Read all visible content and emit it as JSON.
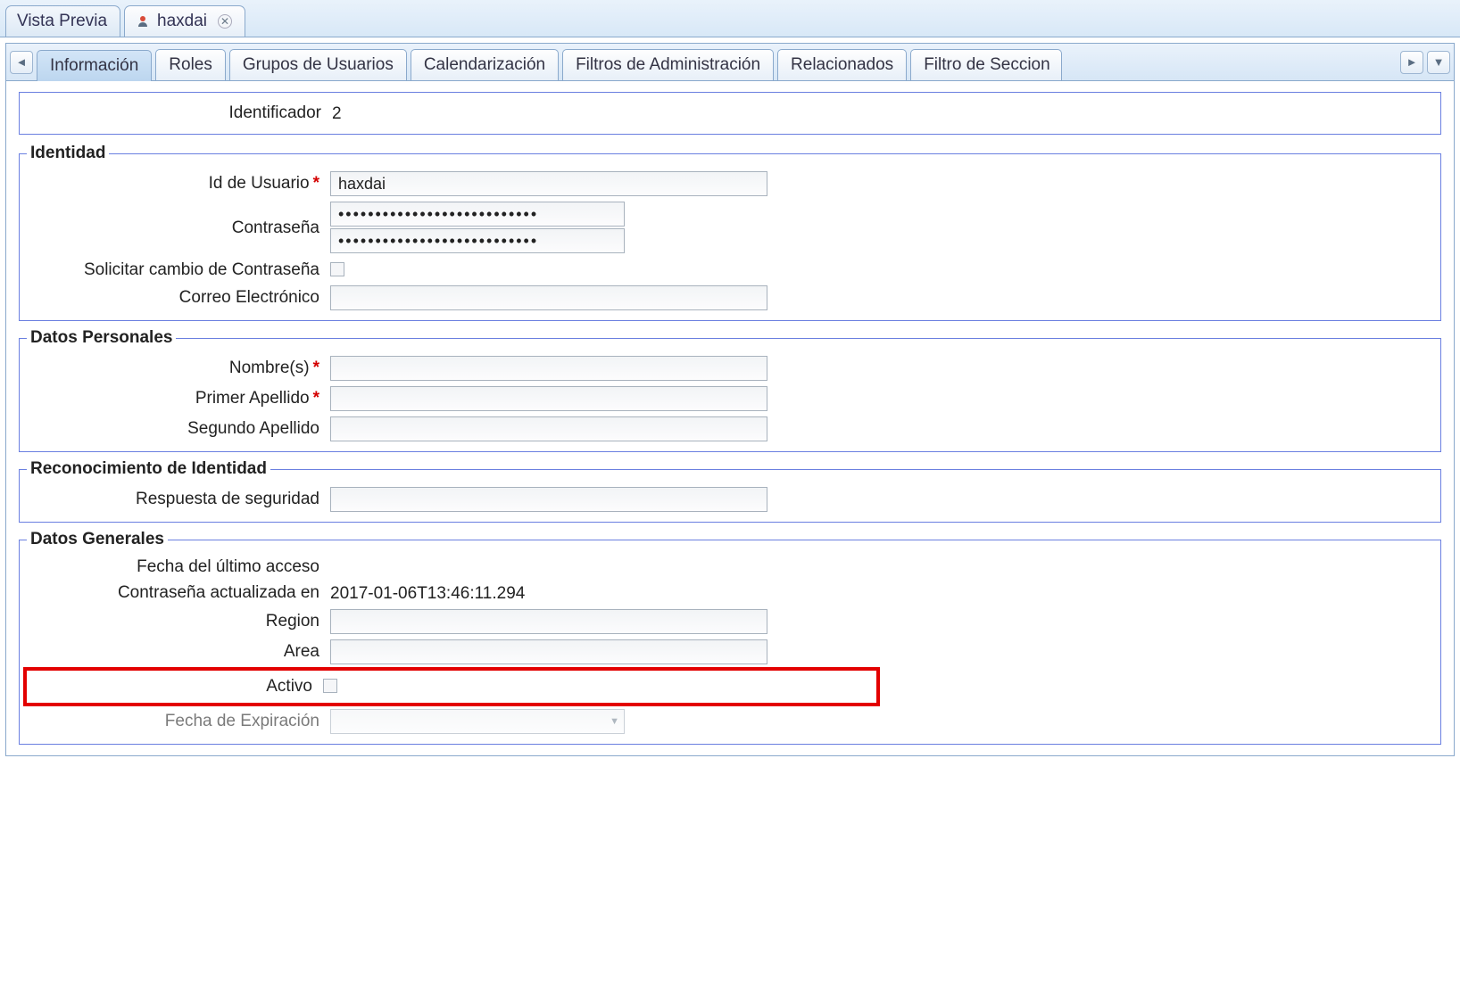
{
  "doc_tabs": {
    "preview_label": "Vista Previa",
    "user_label": "haxdai"
  },
  "sub_tabs": {
    "informacion": "Información",
    "roles": "Roles",
    "grupos": "Grupos de Usuarios",
    "calendarizacion": "Calendarización",
    "filtros_admin": "Filtros de Administración",
    "relacionados": "Relacionados",
    "filtro_seccion": "Filtro de Seccion"
  },
  "top_field": {
    "identificador_label": "Identificador",
    "identificador_value": "2"
  },
  "identidad": {
    "legend": "Identidad",
    "id_usuario_label": "Id de Usuario",
    "id_usuario_value": "haxdai",
    "contrasena_label": "Contraseña",
    "pw_mask": "•••••••••••••••••••••••••••",
    "solicitar_cambio_label": "Solicitar cambio de Contraseña",
    "correo_label": "Correo Electrónico",
    "correo_value": ""
  },
  "datos_personales": {
    "legend": "Datos Personales",
    "nombres_label": "Nombre(s)",
    "nombres_value": "",
    "primer_apellido_label": "Primer Apellido",
    "primer_apellido_value": "",
    "segundo_apellido_label": "Segundo Apellido",
    "segundo_apellido_value": ""
  },
  "reconocimiento": {
    "legend": "Reconocimiento de Identidad",
    "respuesta_label": "Respuesta de seguridad",
    "respuesta_value": ""
  },
  "datos_generales": {
    "legend": "Datos Generales",
    "ultimo_acceso_label": "Fecha del último acceso",
    "ultimo_acceso_value": "",
    "pw_actualizada_label": "Contraseña actualizada en",
    "pw_actualizada_value": "2017-01-06T13:46:11.294",
    "region_label": "Region",
    "region_value": "",
    "area_label": "Area",
    "area_value": "",
    "activo_label": "Activo",
    "fecha_expiracion_label": "Fecha de Expiración",
    "fecha_expiracion_value": ""
  },
  "required_mark": "*"
}
